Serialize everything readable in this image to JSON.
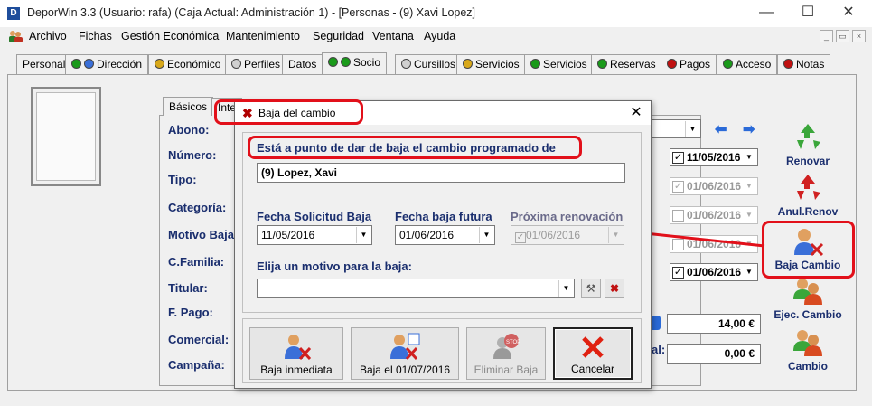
{
  "window": {
    "icon_letter": "D",
    "title": "DeporWin 3.3  (Usuario: rafa)  (Caja Actual: Administración 1) - [Personas - (9) Xavi  Lopez]",
    "minimize": "—",
    "maximize": "☐",
    "close": "✕"
  },
  "menu": [
    "Archivo",
    "Fichas",
    "Gestión Económica",
    "Mantenimiento",
    "Seguridad",
    "Ventana",
    "Ayuda"
  ],
  "mdi_controls": [
    "_",
    "▭",
    "×"
  ],
  "tabs": [
    {
      "label": "Personal",
      "dots": []
    },
    {
      "label": "Dirección",
      "dots": [
        "#1a9a1a",
        "#3a6fd8"
      ]
    },
    {
      "label": "Económico",
      "dots": [
        "#d8a81a"
      ]
    },
    {
      "label": "Perfiles",
      "dots": [
        "#d0d0d0"
      ]
    },
    {
      "label": "Datos",
      "dots": []
    },
    {
      "label": "Socio",
      "dots": [
        "#1a9a1a",
        "#1a9a1a"
      ]
    },
    {
      "label": "Cursillos",
      "dots": [
        "#d0d0d0"
      ]
    },
    {
      "label": "Servicios",
      "dots": [
        "#d8a81a"
      ]
    },
    {
      "label": "Servicios",
      "dots": [
        "#1a9a1a"
      ]
    },
    {
      "label": "Reservas",
      "dots": [
        "#1a9a1a"
      ]
    },
    {
      "label": "Pagos",
      "dots": [
        "#c01010"
      ]
    },
    {
      "label": "Acceso",
      "dots": [
        "#1a9a1a"
      ]
    },
    {
      "label": "Notas",
      "dots": [
        "#c01010"
      ]
    }
  ],
  "subtabs": [
    "Básicos",
    "Inte"
  ],
  "form_labels": [
    "Abono:",
    "Número:",
    "Tipo:",
    "Categoría:",
    "Motivo Baja",
    "C.Familia:",
    "Titular:",
    "F. Pago:",
    "Comercial:",
    "Campaña:"
  ],
  "right_dates": [
    {
      "checked": true,
      "value": "11/05/2016",
      "enabled": true
    },
    {
      "checked": true,
      "value": "01/06/2016",
      "enabled": false
    },
    {
      "checked": false,
      "value": "01/06/2016",
      "enabled": false
    },
    {
      "checked": false,
      "value": "01/06/2016",
      "enabled": false
    },
    {
      "checked": true,
      "value": "01/06/2016",
      "enabled": true
    }
  ],
  "money": {
    "amount1": "14,00 €",
    "amount2": "0,00 €",
    "partial_label": "al:"
  },
  "side_buttons": [
    "Renovar",
    "Anul.Renov",
    "Baja Cambio",
    "Ejec. Cambio",
    "Cambio"
  ],
  "dialog": {
    "title": "Baja del cambio",
    "heading": "Está a punto de dar de baja el cambio programado de",
    "person": "(9)  Lopez, Xavi",
    "fecha_solicitud_label": "Fecha Solicitud Baja",
    "fecha_solicitud_value": "11/05/2016",
    "fecha_futura_label": "Fecha baja futura",
    "fecha_futura_value": "01/06/2016",
    "proxima_label": "Próxima renovación",
    "proxima_value": "01/06/2016",
    "motivo_label": "Elija un motivo para la baja:",
    "motivo_value": "",
    "buttons": {
      "inmediata": "Baja inmediata",
      "fecha": "Baja el 01/07/2016",
      "eliminar": "Eliminar Baja",
      "cancelar": "Cancelar"
    }
  },
  "colors": {
    "label_blue": "#1a2e6e",
    "highlight_red": "#e2101a"
  }
}
